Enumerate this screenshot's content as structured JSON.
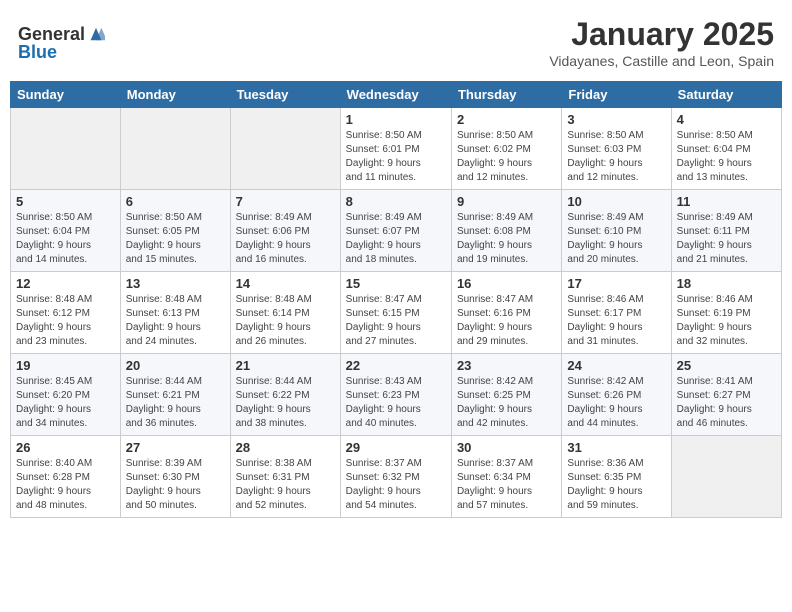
{
  "logo": {
    "general": "General",
    "blue": "Blue"
  },
  "title": {
    "month": "January 2025",
    "location": "Vidayanes, Castille and Leon, Spain"
  },
  "headers": [
    "Sunday",
    "Monday",
    "Tuesday",
    "Wednesday",
    "Thursday",
    "Friday",
    "Saturday"
  ],
  "weeks": [
    [
      {
        "day": "",
        "info": ""
      },
      {
        "day": "",
        "info": ""
      },
      {
        "day": "",
        "info": ""
      },
      {
        "day": "1",
        "info": "Sunrise: 8:50 AM\nSunset: 6:01 PM\nDaylight: 9 hours\nand 11 minutes."
      },
      {
        "day": "2",
        "info": "Sunrise: 8:50 AM\nSunset: 6:02 PM\nDaylight: 9 hours\nand 12 minutes."
      },
      {
        "day": "3",
        "info": "Sunrise: 8:50 AM\nSunset: 6:03 PM\nDaylight: 9 hours\nand 12 minutes."
      },
      {
        "day": "4",
        "info": "Sunrise: 8:50 AM\nSunset: 6:04 PM\nDaylight: 9 hours\nand 13 minutes."
      }
    ],
    [
      {
        "day": "5",
        "info": "Sunrise: 8:50 AM\nSunset: 6:04 PM\nDaylight: 9 hours\nand 14 minutes."
      },
      {
        "day": "6",
        "info": "Sunrise: 8:50 AM\nSunset: 6:05 PM\nDaylight: 9 hours\nand 15 minutes."
      },
      {
        "day": "7",
        "info": "Sunrise: 8:49 AM\nSunset: 6:06 PM\nDaylight: 9 hours\nand 16 minutes."
      },
      {
        "day": "8",
        "info": "Sunrise: 8:49 AM\nSunset: 6:07 PM\nDaylight: 9 hours\nand 18 minutes."
      },
      {
        "day": "9",
        "info": "Sunrise: 8:49 AM\nSunset: 6:08 PM\nDaylight: 9 hours\nand 19 minutes."
      },
      {
        "day": "10",
        "info": "Sunrise: 8:49 AM\nSunset: 6:10 PM\nDaylight: 9 hours\nand 20 minutes."
      },
      {
        "day": "11",
        "info": "Sunrise: 8:49 AM\nSunset: 6:11 PM\nDaylight: 9 hours\nand 21 minutes."
      }
    ],
    [
      {
        "day": "12",
        "info": "Sunrise: 8:48 AM\nSunset: 6:12 PM\nDaylight: 9 hours\nand 23 minutes."
      },
      {
        "day": "13",
        "info": "Sunrise: 8:48 AM\nSunset: 6:13 PM\nDaylight: 9 hours\nand 24 minutes."
      },
      {
        "day": "14",
        "info": "Sunrise: 8:48 AM\nSunset: 6:14 PM\nDaylight: 9 hours\nand 26 minutes."
      },
      {
        "day": "15",
        "info": "Sunrise: 8:47 AM\nSunset: 6:15 PM\nDaylight: 9 hours\nand 27 minutes."
      },
      {
        "day": "16",
        "info": "Sunrise: 8:47 AM\nSunset: 6:16 PM\nDaylight: 9 hours\nand 29 minutes."
      },
      {
        "day": "17",
        "info": "Sunrise: 8:46 AM\nSunset: 6:17 PM\nDaylight: 9 hours\nand 31 minutes."
      },
      {
        "day": "18",
        "info": "Sunrise: 8:46 AM\nSunset: 6:19 PM\nDaylight: 9 hours\nand 32 minutes."
      }
    ],
    [
      {
        "day": "19",
        "info": "Sunrise: 8:45 AM\nSunset: 6:20 PM\nDaylight: 9 hours\nand 34 minutes."
      },
      {
        "day": "20",
        "info": "Sunrise: 8:44 AM\nSunset: 6:21 PM\nDaylight: 9 hours\nand 36 minutes."
      },
      {
        "day": "21",
        "info": "Sunrise: 8:44 AM\nSunset: 6:22 PM\nDaylight: 9 hours\nand 38 minutes."
      },
      {
        "day": "22",
        "info": "Sunrise: 8:43 AM\nSunset: 6:23 PM\nDaylight: 9 hours\nand 40 minutes."
      },
      {
        "day": "23",
        "info": "Sunrise: 8:42 AM\nSunset: 6:25 PM\nDaylight: 9 hours\nand 42 minutes."
      },
      {
        "day": "24",
        "info": "Sunrise: 8:42 AM\nSunset: 6:26 PM\nDaylight: 9 hours\nand 44 minutes."
      },
      {
        "day": "25",
        "info": "Sunrise: 8:41 AM\nSunset: 6:27 PM\nDaylight: 9 hours\nand 46 minutes."
      }
    ],
    [
      {
        "day": "26",
        "info": "Sunrise: 8:40 AM\nSunset: 6:28 PM\nDaylight: 9 hours\nand 48 minutes."
      },
      {
        "day": "27",
        "info": "Sunrise: 8:39 AM\nSunset: 6:30 PM\nDaylight: 9 hours\nand 50 minutes."
      },
      {
        "day": "28",
        "info": "Sunrise: 8:38 AM\nSunset: 6:31 PM\nDaylight: 9 hours\nand 52 minutes."
      },
      {
        "day": "29",
        "info": "Sunrise: 8:37 AM\nSunset: 6:32 PM\nDaylight: 9 hours\nand 54 minutes."
      },
      {
        "day": "30",
        "info": "Sunrise: 8:37 AM\nSunset: 6:34 PM\nDaylight: 9 hours\nand 57 minutes."
      },
      {
        "day": "31",
        "info": "Sunrise: 8:36 AM\nSunset: 6:35 PM\nDaylight: 9 hours\nand 59 minutes."
      },
      {
        "day": "",
        "info": ""
      }
    ]
  ]
}
